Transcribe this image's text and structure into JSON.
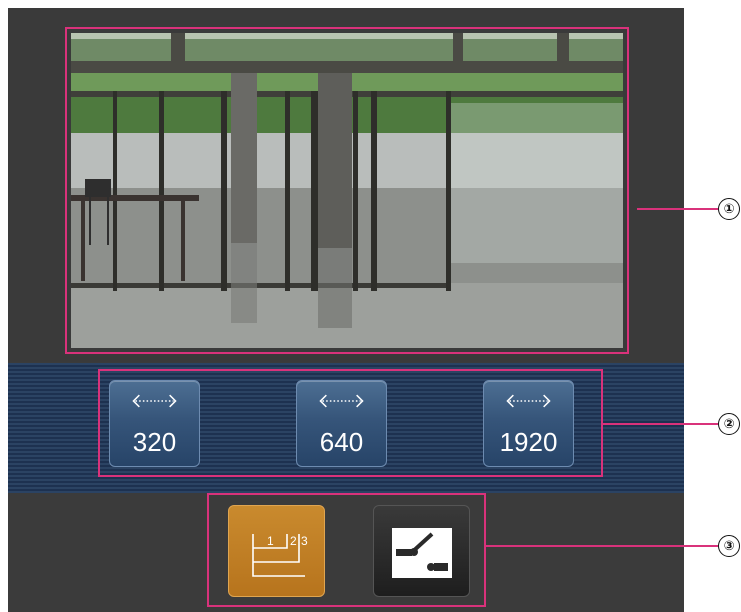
{
  "resolution_buttons": [
    {
      "label": "320"
    },
    {
      "label": "640"
    },
    {
      "label": "1920"
    }
  ],
  "mode_buttons": {
    "multi_screen": {
      "icon": "multi-screen-icon",
      "labels": [
        "1",
        "2",
        "3"
      ]
    },
    "setup": {
      "icon": "setup-icon"
    }
  },
  "callouts": [
    {
      "number": "①"
    },
    {
      "number": "②"
    },
    {
      "number": "③"
    }
  ],
  "colors": {
    "highlight": "#d9327b",
    "active_button": "#c98a2e",
    "resolution_button": "#36557a"
  }
}
